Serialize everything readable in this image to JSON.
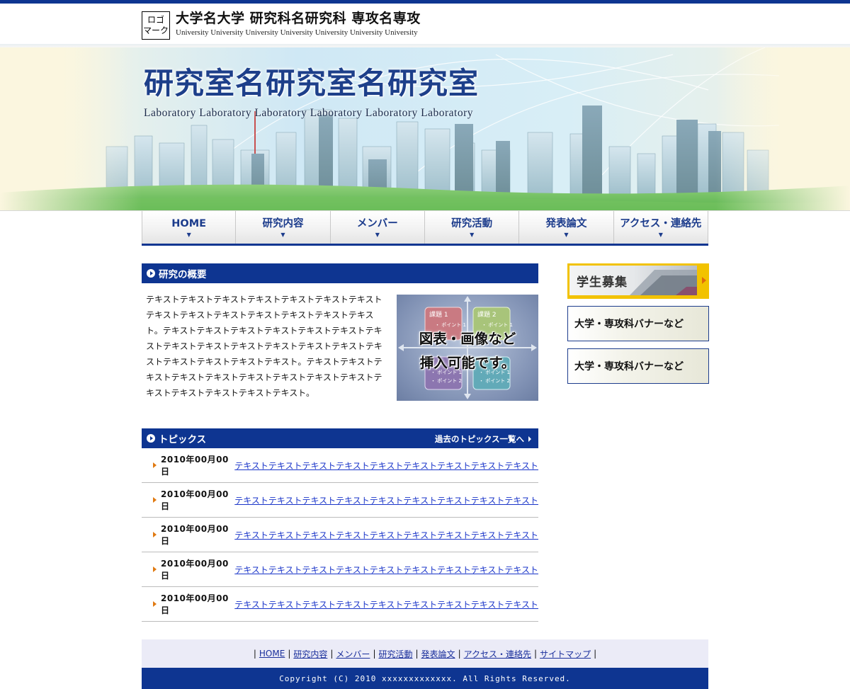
{
  "header": {
    "logo_line1": "ロゴ",
    "logo_line2": "マーク",
    "title": "大学名大学 研究科名研究科 専攻名専攻",
    "subtitle": "University University University University University University University"
  },
  "hero": {
    "title": "研究室名研究室名研究室",
    "subtitle": "Laboratory Laboratory  Laboratory Laboratory Laboratory Laboratory"
  },
  "nav": {
    "items": [
      {
        "label": "HOME"
      },
      {
        "label": "研究内容"
      },
      {
        "label": "メンバー"
      },
      {
        "label": "研究活動"
      },
      {
        "label": "発表論文"
      },
      {
        "label": "アクセス・連絡先"
      }
    ],
    "arrow": "▼"
  },
  "overview": {
    "heading": "研究の概要",
    "text": "テキストテキストテキストテキストテキストテキストテキストテキストテキストテキストテキストテキストテキストテキスト。テキストテキストテキストテキストテキストテキストテキストテキストテキストテキストテキストテキストテキストテキストテキストテキストテキストテキスト。テキストテキストテキストテキストテキストテキストテキストテキストテキストテキストテキストテキストテキストテキスト。",
    "figure": {
      "box1_title": "課題 1",
      "box2_title": "課題 2",
      "point1": "・ ポイント 1",
      "point2": "・ ポイント 2",
      "caption1": "図表・画像など",
      "caption2": "挿入可能です。"
    }
  },
  "topics": {
    "heading": "トピックス",
    "more_link": "過去のトピックス一覧へ",
    "items": [
      {
        "date": "2010年00月00日",
        "text": "テキストテキストテキストテキストテキストテキストテキストテキストテキスト"
      },
      {
        "date": "2010年00月00日",
        "text": "テキストテキストテキストテキストテキストテキストテキストテキストテキスト"
      },
      {
        "date": "2010年00月00日",
        "text": "テキストテキストテキストテキストテキストテキストテキストテキストテキスト"
      },
      {
        "date": "2010年00月00日",
        "text": "テキストテキストテキストテキストテキストテキストテキストテキストテキスト"
      },
      {
        "date": "2010年00月00日",
        "text": "テキストテキストテキストテキストテキストテキストテキストテキストテキスト"
      }
    ]
  },
  "sidebar": {
    "recruit": "学生募集",
    "banners": [
      {
        "label": "大学・専攻科バナーなど"
      },
      {
        "label": "大学・専攻科バナーなど"
      }
    ]
  },
  "footer": {
    "separator": "|",
    "links": [
      {
        "label": "HOME"
      },
      {
        "label": "研究内容"
      },
      {
        "label": "メンバー"
      },
      {
        "label": "研究活動"
      },
      {
        "label": "発表論文"
      },
      {
        "label": "アクセス・連絡先"
      },
      {
        "label": "サイトマップ"
      }
    ],
    "copyright": "Copyright (C) 2010 xxxxxxxxxxxxx. All Rights Reserved."
  },
  "colors": {
    "brand_navy": "#0e3591",
    "nav_text": "#1c3c8c",
    "link_blue": "#1a35c9",
    "accent_orange": "#e07a12",
    "recruit_yellow": "#f2c200"
  }
}
